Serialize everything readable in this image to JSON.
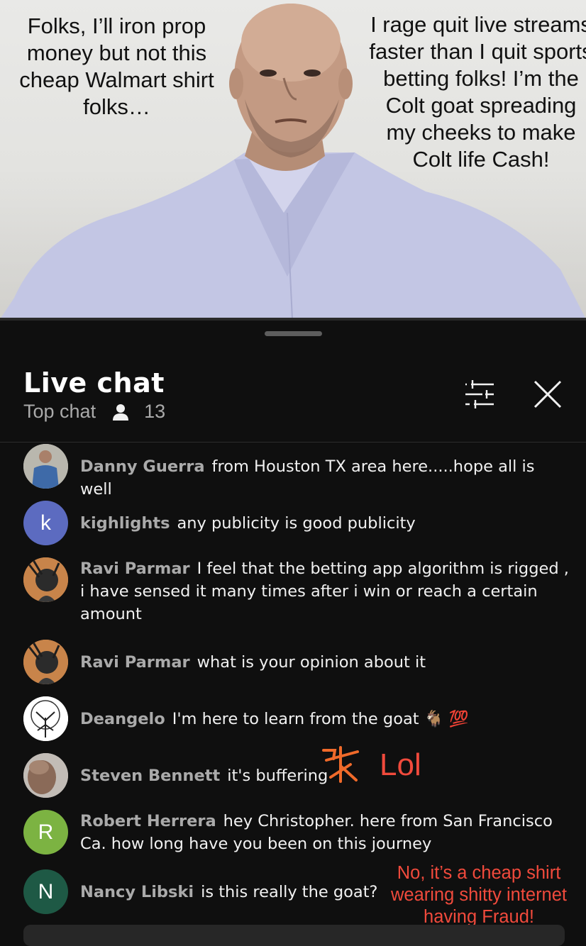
{
  "video": {
    "caption_left": "Folks, I’ll iron prop money but not this cheap Walmart shirt folks…",
    "caption_right": "I rage quit live streams faster than I quit sports betting folks! I’m the Colt goat spreading my cheeks to make Colt life Cash!"
  },
  "chat": {
    "title": "Live chat",
    "mode": "Top chat",
    "viewer_count": "13",
    "messages": [
      {
        "author": "Danny Guerra",
        "text": "from Houston TX area here.....hope all is well",
        "avatar": "photo"
      },
      {
        "author": "kighlights",
        "text": "any publicity is good publicity",
        "avatar_letter": "k",
        "avatar_color": "#5c6bc0"
      },
      {
        "author": "Ravi Parmar",
        "text": "I feel that the betting app algorithm is rigged , i have sensed it many times after i win or reach a certain amount",
        "avatar": "illustration"
      },
      {
        "author": "Ravi Parmar",
        "text": "what is your opinion about it",
        "avatar": "illustration"
      },
      {
        "author": "Deangelo",
        "text": "I'm here to learn from the goat 🐐 💯",
        "avatar": "tree"
      },
      {
        "author": "Steven Bennett",
        "text": "it's buffering",
        "avatar": "photo"
      },
      {
        "author": "Robert Herrera",
        "text": "hey Christopher. here from San Francisco Ca. how long have you been on this journey",
        "avatar_letter": "R",
        "avatar_color": "#7cb342"
      },
      {
        "author": "Nancy Libski",
        "text": "is this really the goat?",
        "avatar_letter": "N",
        "avatar_color": "#1e5945"
      }
    ]
  },
  "overlay": {
    "lol": "Lol",
    "fraud_note": "No, it’s a cheap shirt wearing shitty internet having Fraud!"
  },
  "colors": {
    "accent_red": "#f04a3c",
    "background": "#0f0f0f"
  },
  "icons": [
    "person-icon",
    "filter-sliders-icon",
    "close-icon",
    "goat-icon",
    "hundred-points-icon",
    "scribble-icon"
  ]
}
